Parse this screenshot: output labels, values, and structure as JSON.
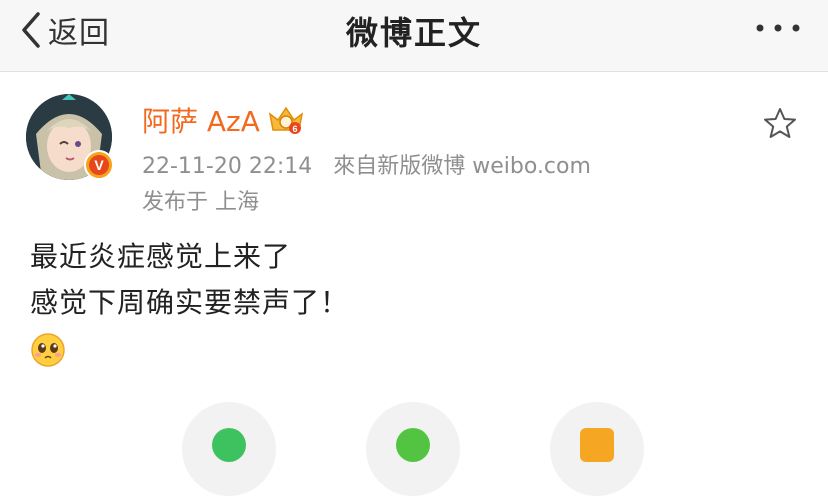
{
  "nav": {
    "back_label": "返回",
    "title": "微博正文"
  },
  "author": {
    "name": "阿萨 AzA",
    "verified_badge": "V",
    "timestamp": "22-11-20 22:14",
    "source": "來自新版微博 weibo.com",
    "location": "发布于 上海"
  },
  "post": {
    "lines": [
      "最近炎症感觉上来了",
      "感觉下周确实要禁声了！"
    ],
    "emoji": "cute-pleading-emoji"
  },
  "actions": [
    {
      "icon": "wechat-share-icon",
      "color": "#3ec260"
    },
    {
      "icon": "moments-share-icon",
      "color": "#52c441"
    },
    {
      "icon": "favorite-icon",
      "color": "#f5a623"
    }
  ],
  "colors": {
    "accent_name": "#f26a20",
    "meta_gray": "#8f8f8f",
    "navbar_bg": "#f7f7f7"
  }
}
